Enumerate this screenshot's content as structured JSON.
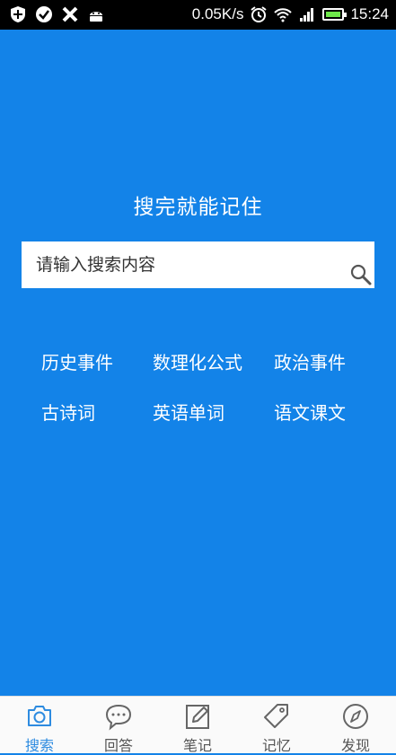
{
  "status_bar": {
    "left_icons": [
      "plus-shield-icon",
      "check-circle-icon",
      "tools-icon",
      "android-icon"
    ],
    "network_speed": "0.05K/s",
    "right_icons": [
      "alarm-icon",
      "wifi-icon",
      "signal-icon",
      "battery-icon"
    ],
    "time": "15:24"
  },
  "main": {
    "slogan": "搜完就能记住",
    "search": {
      "placeholder": "请输入搜索内容",
      "value": ""
    },
    "categories": [
      [
        "历史事件",
        "数理化公式",
        "政治事件"
      ],
      [
        "古诗词",
        "英语单词",
        "语文课文"
      ]
    ]
  },
  "tabbar": {
    "tabs": [
      {
        "label": "搜索",
        "icon": "camera-icon",
        "active": true
      },
      {
        "label": "回答",
        "icon": "chat-icon",
        "active": false
      },
      {
        "label": "笔记",
        "icon": "note-edit-icon",
        "active": false
      },
      {
        "label": "记忆",
        "icon": "tag-icon",
        "active": false
      },
      {
        "label": "发现",
        "icon": "compass-icon",
        "active": false
      }
    ]
  },
  "colors": {
    "primary_blue": "#1383e8",
    "tab_active": "#2d8be0",
    "tab_inactive": "#555555"
  }
}
